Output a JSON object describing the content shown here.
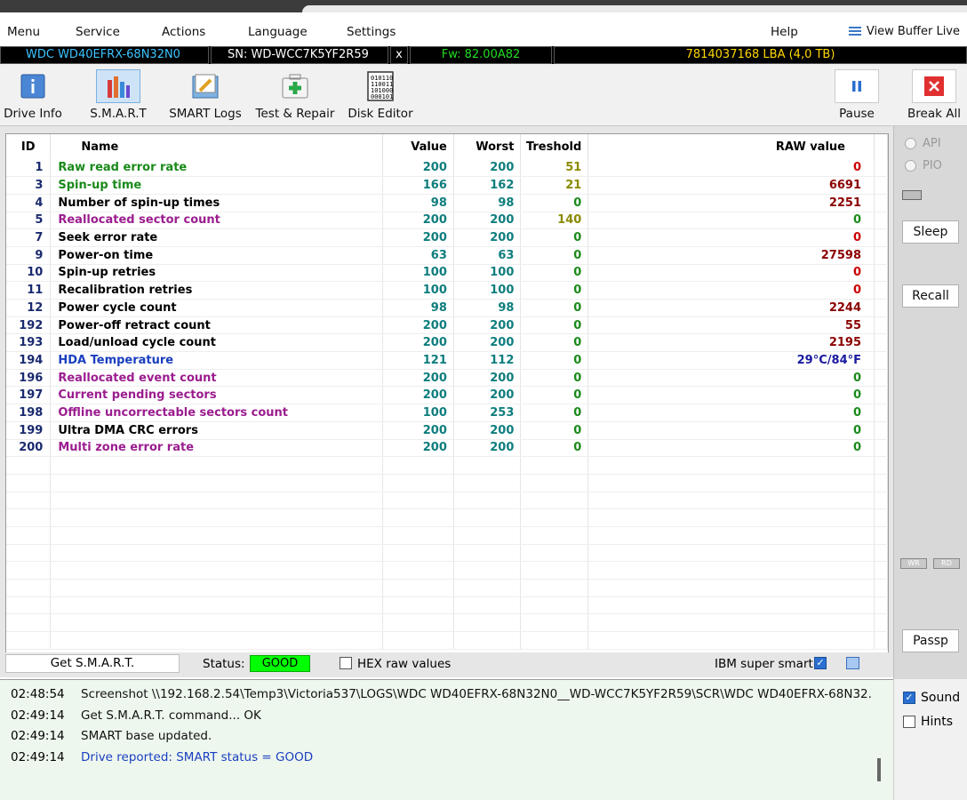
{
  "menu": {
    "items": [
      "Menu",
      "Service",
      "Actions",
      "Language",
      "Settings",
      "Help"
    ],
    "view_buffer": "View Buffer Live"
  },
  "drive": {
    "model": "WDC WD40EFRX-68N32N0",
    "serial": "SN: WD-WCC7K5YF2R59",
    "close": "x",
    "firmware": "Fw: 82.00A82",
    "capacity": "7814037168 LBA (4,0 TB)"
  },
  "toolbar": {
    "drive_info": "Drive Info",
    "smart": "S.M.A.R.T",
    "smart_logs": "SMART Logs",
    "test_repair": "Test & Repair",
    "disk_editor": "Disk Editor",
    "pause": "Pause",
    "break_all": "Break All"
  },
  "table": {
    "headers": {
      "id": "ID",
      "name": "Name",
      "value": "Value",
      "worst": "Worst",
      "treshold": "Treshold",
      "raw": "RAW value"
    },
    "rows": [
      {
        "id": "1",
        "name": "Raw read error rate",
        "value": "200",
        "worst": "200",
        "treshold": "51",
        "raw": "0",
        "name_color": "#1a8a1a",
        "tres_color": "#8a8a00",
        "raw_color": "#cc0000"
      },
      {
        "id": "3",
        "name": "Spin-up time",
        "value": "166",
        "worst": "162",
        "treshold": "21",
        "raw": "6691",
        "name_color": "#1a8a1a",
        "tres_color": "#8a8a00",
        "raw_color": "#8b0000"
      },
      {
        "id": "4",
        "name": "Number of spin-up times",
        "value": "98",
        "worst": "98",
        "treshold": "0",
        "raw": "2251",
        "name_color": "#000000",
        "tres_color": "#1a8a1a",
        "raw_color": "#8b0000"
      },
      {
        "id": "5",
        "name": "Reallocated sector count",
        "value": "200",
        "worst": "200",
        "treshold": "140",
        "raw": "0",
        "name_color": "#9b1d8f",
        "tres_color": "#8a8a00",
        "raw_color": "#1a8a1a"
      },
      {
        "id": "7",
        "name": "Seek error rate",
        "value": "200",
        "worst": "200",
        "treshold": "0",
        "raw": "0",
        "name_color": "#000000",
        "tres_color": "#1a8a1a",
        "raw_color": "#cc0000"
      },
      {
        "id": "9",
        "name": "Power-on time",
        "value": "63",
        "worst": "63",
        "treshold": "0",
        "raw": "27598",
        "name_color": "#000000",
        "tres_color": "#1a8a1a",
        "raw_color": "#8b0000"
      },
      {
        "id": "10",
        "name": "Spin-up retries",
        "value": "100",
        "worst": "100",
        "treshold": "0",
        "raw": "0",
        "name_color": "#000000",
        "tres_color": "#1a8a1a",
        "raw_color": "#cc0000"
      },
      {
        "id": "11",
        "name": "Recalibration retries",
        "value": "100",
        "worst": "100",
        "treshold": "0",
        "raw": "0",
        "name_color": "#000000",
        "tres_color": "#1a8a1a",
        "raw_color": "#cc0000"
      },
      {
        "id": "12",
        "name": "Power cycle count",
        "value": "98",
        "worst": "98",
        "treshold": "0",
        "raw": "2244",
        "name_color": "#000000",
        "tres_color": "#1a8a1a",
        "raw_color": "#8b0000"
      },
      {
        "id": "192",
        "name": "Power-off retract count",
        "value": "200",
        "worst": "200",
        "treshold": "0",
        "raw": "55",
        "name_color": "#000000",
        "tres_color": "#1a8a1a",
        "raw_color": "#8b0000"
      },
      {
        "id": "193",
        "name": "Load/unload cycle count",
        "value": "200",
        "worst": "200",
        "treshold": "0",
        "raw": "2195",
        "name_color": "#000000",
        "tres_color": "#1a8a1a",
        "raw_color": "#8b0000"
      },
      {
        "id": "194",
        "name": "HDA Temperature",
        "value": "121",
        "worst": "112",
        "treshold": "0",
        "raw": "29°C/84°F",
        "name_color": "#1a3fbf",
        "tres_color": "#1a8a1a",
        "raw_color": "#1a1a9f"
      },
      {
        "id": "196",
        "name": "Reallocated event count",
        "value": "200",
        "worst": "200",
        "treshold": "0",
        "raw": "0",
        "name_color": "#9b1d8f",
        "tres_color": "#1a8a1a",
        "raw_color": "#1a8a1a"
      },
      {
        "id": "197",
        "name": "Current pending sectors",
        "value": "200",
        "worst": "200",
        "treshold": "0",
        "raw": "0",
        "name_color": "#9b1d8f",
        "tres_color": "#1a8a1a",
        "raw_color": "#1a8a1a"
      },
      {
        "id": "198",
        "name": "Offline uncorrectable sectors count",
        "value": "100",
        "worst": "253",
        "treshold": "0",
        "raw": "0",
        "name_color": "#9b1d8f",
        "tres_color": "#1a8a1a",
        "raw_color": "#1a8a1a"
      },
      {
        "id": "199",
        "name": "Ultra DMA CRC errors",
        "value": "200",
        "worst": "200",
        "treshold": "0",
        "raw": "0",
        "name_color": "#000000",
        "tres_color": "#1a8a1a",
        "raw_color": "#1a8a1a"
      },
      {
        "id": "200",
        "name": "Multi zone error rate",
        "value": "200",
        "worst": "200",
        "treshold": "0",
        "raw": "0",
        "name_color": "#9b1d8f",
        "tres_color": "#1a8a1a",
        "raw_color": "#1a8a1a"
      }
    ]
  },
  "bottom": {
    "get_smart": "Get S.M.A.R.T.",
    "status_label": "Status:",
    "status_value": "GOOD",
    "hex_label": "HEX raw values",
    "ibm_label": "IBM super smart:"
  },
  "right_panel": {
    "api": "API",
    "pio": "PIO",
    "sleep": "Sleep",
    "recall": "Recall",
    "wr": "WR",
    "rd": "RD",
    "passp": "Passp"
  },
  "log": [
    {
      "time": "02:48:54",
      "text": "Screenshot \\\\192.168.2.54\\Temp3\\Victoria537\\LOGS\\WDC WD40EFRX-68N32N0__WD-WCC7K5YF2R59\\SCR\\WDC WD40EFRX-68N32.",
      "color": "#111111"
    },
    {
      "time": "02:49:14",
      "text": "Get S.M.A.R.T. command... OK",
      "color": "#111111"
    },
    {
      "time": "02:49:14",
      "text": "SMART base updated.",
      "color": "#111111"
    },
    {
      "time": "02:49:14",
      "text": "Drive reported: SMART status = GOOD",
      "color": "#1a3fbf"
    }
  ],
  "log_options": {
    "sound": "Sound",
    "hints": "Hints"
  },
  "colors": {
    "value_teal": "#0f7d7d",
    "id_navy": "#1a2a6f",
    "status_green": "#00ff00"
  }
}
